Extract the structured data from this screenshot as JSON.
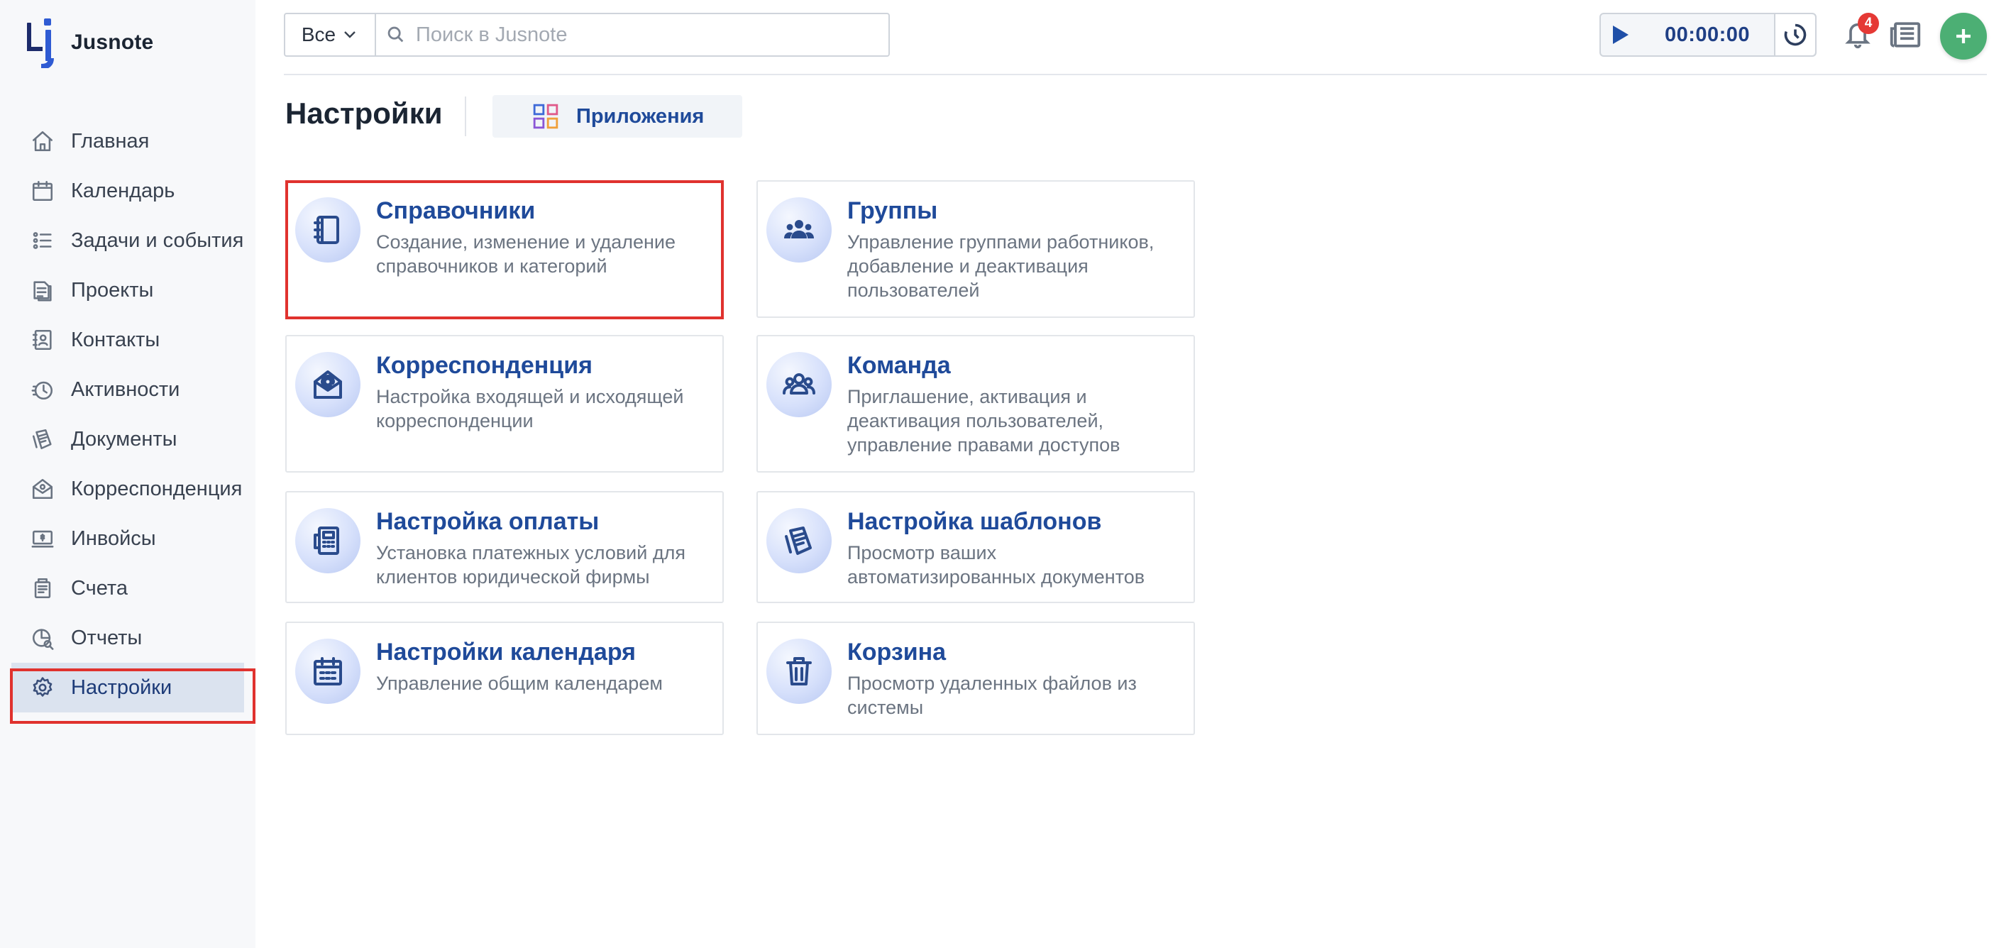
{
  "app": {
    "name": "Jusnote"
  },
  "sidebar": {
    "items": [
      {
        "label": "Главная",
        "icon": "home-icon"
      },
      {
        "label": "Календарь",
        "icon": "calendar-icon"
      },
      {
        "label": "Задачи и события",
        "icon": "tasks-icon"
      },
      {
        "label": "Проекты",
        "icon": "projects-icon"
      },
      {
        "label": "Контакты",
        "icon": "contacts-icon"
      },
      {
        "label": "Активности",
        "icon": "activity-icon"
      },
      {
        "label": "Документы",
        "icon": "documents-icon"
      },
      {
        "label": "Корреспонденция",
        "icon": "correspondence-icon"
      },
      {
        "label": "Инвойсы",
        "icon": "invoice-icon"
      },
      {
        "label": "Счета",
        "icon": "accounts-icon"
      },
      {
        "label": "Отчеты",
        "icon": "reports-icon"
      },
      {
        "label": "Настройки",
        "icon": "gear-icon",
        "active": true
      }
    ]
  },
  "topbar": {
    "scope_value": "Все",
    "search_placeholder": "Поиск в Jusnote",
    "search_value": "",
    "timer_value": "00:00:00",
    "notifications_count": "4"
  },
  "page": {
    "title": "Настройки",
    "apps_tab_label": "Приложения"
  },
  "cards": [
    {
      "title": "Справочники",
      "desc": "Создание, изменение и удаление справочников и категорий",
      "icon": "directory-book-icon",
      "highlighted": true
    },
    {
      "title": "Группы",
      "desc": "Управление группами работников, добавление и деактивация пользователей",
      "icon": "groups-icon"
    },
    {
      "title": "Корреспонденция",
      "desc": "Настройка входящей и исходящей корреспонденции",
      "icon": "mail-envelope-icon"
    },
    {
      "title": "Команда",
      "desc": "Приглашение, активация и деактивация пользователей, управление правами доступов",
      "icon": "team-icon"
    },
    {
      "title": "Настройка оплаты",
      "desc": "Установка платежных условий для клиентов юридической фирмы",
      "icon": "payment-terminal-icon"
    },
    {
      "title": "Настройка шаблонов",
      "desc": "Просмотр ваших автоматизированных документов",
      "icon": "templates-icon"
    },
    {
      "title": "Настройки календаря",
      "desc": "Управление общим календарем",
      "icon": "calendar-settings-icon"
    },
    {
      "title": "Корзина",
      "desc": "Просмотр удаленных файлов из системы",
      "icon": "trash-icon"
    }
  ],
  "colors": {
    "accent": "#1f4a9a",
    "highlight": "#e0322e",
    "add_button": "#4caf74",
    "badge": "#e53935"
  }
}
